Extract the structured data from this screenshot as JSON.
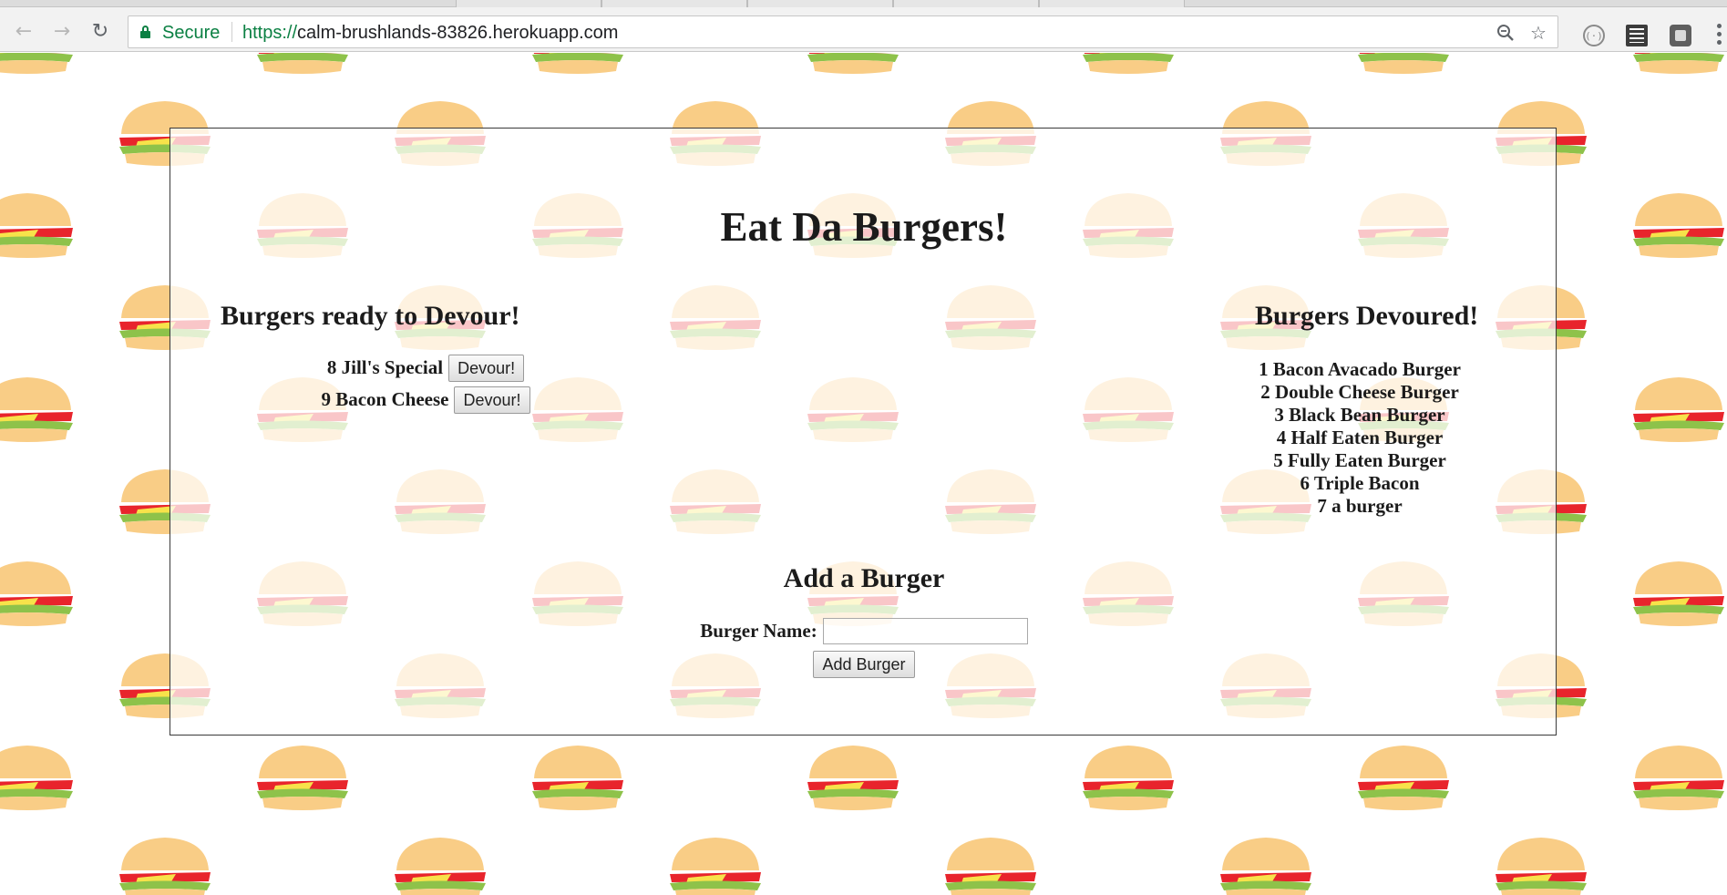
{
  "browser": {
    "secure_label": "Secure",
    "url_scheme": "https://",
    "url_host": "calm-brushlands-83826.herokuapp.com",
    "icons": [
      "back-arrow-icon",
      "forward-arrow-icon",
      "reload-icon",
      "lock-icon",
      "zoom-icon",
      "star-icon",
      "extension-icon",
      "menu-icon"
    ]
  },
  "page": {
    "title": "Eat Da Burgers!",
    "ready_heading": "Burgers ready to Devour!",
    "devoured_heading": "Burgers Devoured!",
    "ready_burgers": [
      {
        "id": 8,
        "label": "8 Jill's Special",
        "button": "Devour!"
      },
      {
        "id": 9,
        "label": "9 Bacon Cheese",
        "button": "Devour!"
      }
    ],
    "devoured_burgers": [
      "1 Bacon Avacado Burger",
      "2 Double Cheese Burger",
      "3 Black Bean Burger",
      "4 Half Eaten Burger",
      "5 Fully Eaten Burger",
      "6 Triple Bacon",
      "7 a burger"
    ],
    "add_heading": "Add a Burger",
    "form": {
      "label": "Burger Name:",
      "value": "",
      "submit_label": "Add Burger"
    }
  },
  "colors": {
    "secure_green": "#0b8043",
    "bun": "#f9cd86",
    "tomato": "#e8242c",
    "lettuce": "#8ec24a",
    "cheese": "#f7e24a"
  }
}
